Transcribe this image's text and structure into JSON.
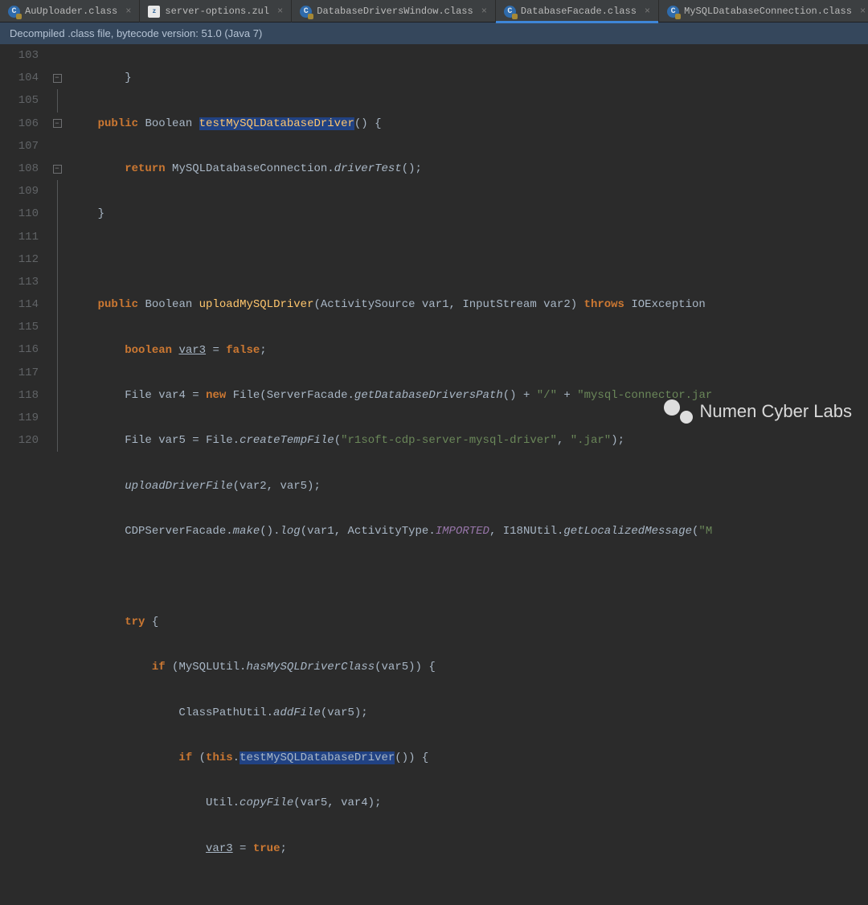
{
  "tabs": [
    {
      "label": "AuUploader.class",
      "icon": "class",
      "active": false
    },
    {
      "label": "server-options.zul",
      "icon": "zul",
      "active": false
    },
    {
      "label": "DatabaseDriversWindow.class",
      "icon": "class",
      "active": false
    },
    {
      "label": "DatabaseFacade.class",
      "icon": "class",
      "active": true
    },
    {
      "label": "MySQLDatabaseConnection.class",
      "icon": "class",
      "active": false
    }
  ],
  "banner": "Decompiled .class file, bytecode version: 51.0 (Java 7)",
  "line_start": 103,
  "line_end": 120,
  "code": {
    "l103": "        }",
    "l104_public": "public",
    "l104_ret": "Boolean",
    "l104_name": "testMySQLDatabaseDriver",
    "l104_rest": "() {",
    "l105_ret": "return",
    "l105_class": "MySQLDatabaseConnection",
    "l105_call": "driverTest",
    "l105_rest": "();",
    "l106": "    }",
    "l108_public": "public",
    "l108_ret": "Boolean",
    "l108_name": "uploadMySQLDriver",
    "l108_args": "(ActivitySource var1, InputStream var2)",
    "l108_throws": "throws",
    "l108_exc": "IOException",
    "l109_type": "boolean",
    "l109_var": "var3",
    "l109_eq": " = ",
    "l109_val": "false",
    "l109_semi": ";",
    "l110_type": "File",
    "l110_var": "var4",
    "l110_new": "new",
    "l110_ctor": "File",
    "l110_a": "(ServerFacade.",
    "l110_call": "getDatabaseDriversPath",
    "l110_b": "() + ",
    "l110_s1": "\"/\"",
    "l110_c": " + ",
    "l110_s2": "\"mysql-connector.jar",
    "l111_type": "File",
    "l111_var": "var5",
    "l111_cls": "File",
    "l111_call": "createTempFile",
    "l111_a": "(",
    "l111_s1": "\"r1soft-cdp-server-mysql-driver\"",
    "l111_b": ", ",
    "l111_s2": "\".jar\"",
    "l111_c": ");",
    "l112_call": "uploadDriverFile",
    "l112_args": "(var2, var5);",
    "l113_cls": "CDPServerFacade",
    "l113_make": "make",
    "l113_a": "().",
    "l113_log": "log",
    "l113_b": "(var1, ActivityType.",
    "l113_imp": "IMPORTED",
    "l113_c": ", I18NUtil.",
    "l113_get": "getLocalizedMessage",
    "l113_d": "(",
    "l113_e": "\"M",
    "l115_try": "try",
    "l115_b": " {",
    "l116_if": "if",
    "l116_a": " (MySQLUtil.",
    "l116_call": "hasMySQLDriverClass",
    "l116_b": "(var5)) {",
    "l117_cls": "ClassPathUtil",
    "l117_call": "addFile",
    "l117_b": "(var5);",
    "l118_if": "if",
    "l118_a": " (",
    "l118_this": "this",
    "l118_dot": ".",
    "l118_call": "testMySQLDatabaseDriver",
    "l118_b": "()) {",
    "l119_cls": "Util",
    "l119_call": "copyFile",
    "l119_b": "(var5, var4);",
    "l120_var": "var3",
    "l120_eq": " = ",
    "l120_val": "true",
    "l120_semi": ";"
  },
  "watermark_text": "Numen Cyber Labs"
}
